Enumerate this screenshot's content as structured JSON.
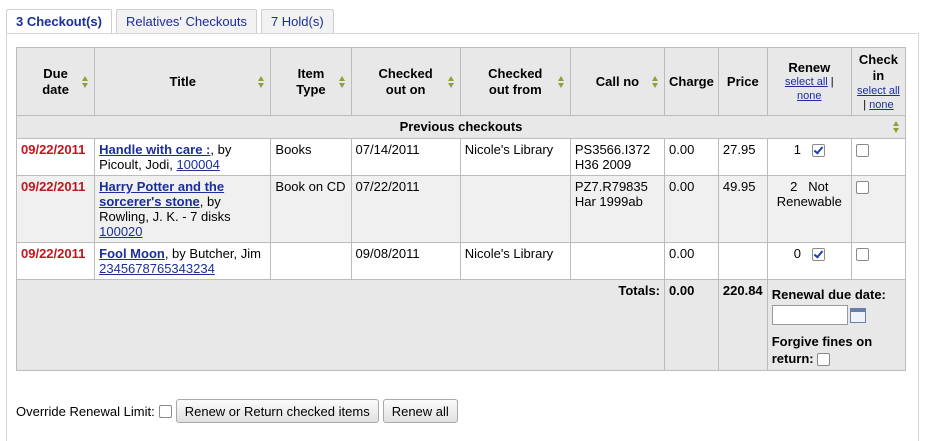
{
  "tabs": [
    {
      "label": "3 Checkout(s)",
      "active": true
    },
    {
      "label": "Relatives' Checkouts",
      "active": false
    },
    {
      "label": "7 Hold(s)",
      "active": false
    }
  ],
  "table": {
    "headers": {
      "due_date": "Due date",
      "title": "Title",
      "item_type": "Item Type",
      "checked_out_on": "Checked out on",
      "checked_out_from": "Checked out from",
      "call_no": "Call no",
      "charge": "Charge",
      "price": "Price",
      "renew": "Renew",
      "renew_select_all": "select all",
      "renew_sep": "|",
      "renew_none": "none",
      "check_in": "Check in",
      "checkin_select_all": "select all",
      "checkin_sep": "|",
      "checkin_none": "none"
    },
    "group_label": "Previous checkouts",
    "rows": [
      {
        "due": "09/22/2011",
        "title": "Handle with care :",
        "author": ", by Picoult, Jodi,",
        "barcode": "100004",
        "item_type": "Books",
        "checked_out_on": "07/14/2011",
        "checked_out_from": "Nicole's Library",
        "call_no": "PS3566.I372 H36 2009",
        "charge": "0.00",
        "price": "27.95",
        "renew_count": "1",
        "renew_status": "",
        "renew_checked": true,
        "checkin_checked": false
      },
      {
        "due": "09/22/2011",
        "title": "Harry Potter and the sorcerer's stone",
        "author": ", by Rowling, J. K. - 7 disks",
        "barcode": "100020",
        "item_type": "Book on CD",
        "checked_out_on": "07/22/2011",
        "checked_out_from": "",
        "call_no": "PZ7.R79835 Har 1999ab",
        "charge": "0.00",
        "price": "49.95",
        "renew_count": "2",
        "renew_status": "Not Renewable",
        "renew_checked": false,
        "checkin_checked": false
      },
      {
        "due": "09/22/2011",
        "title": "Fool Moon",
        "author": ", by Butcher, Jim",
        "barcode": "2345678765343234",
        "item_type": "",
        "checked_out_on": "09/08/2011",
        "checked_out_from": "Nicole's Library",
        "call_no": "",
        "charge": "0.00",
        "price": "",
        "renew_count": "0",
        "renew_status": "",
        "renew_checked": true,
        "checkin_checked": false
      }
    ],
    "totals": {
      "label": "Totals:",
      "charge": "0.00",
      "price": "220.84",
      "renewal_due_label": "Renewal due date:",
      "renewal_due_value": "",
      "forgive_label": "Forgive fines on return:"
    }
  },
  "bottom": {
    "override_label": "Override Renewal Limit:",
    "renew_return_button": "Renew or Return checked items",
    "renew_all_button": "Renew all"
  }
}
